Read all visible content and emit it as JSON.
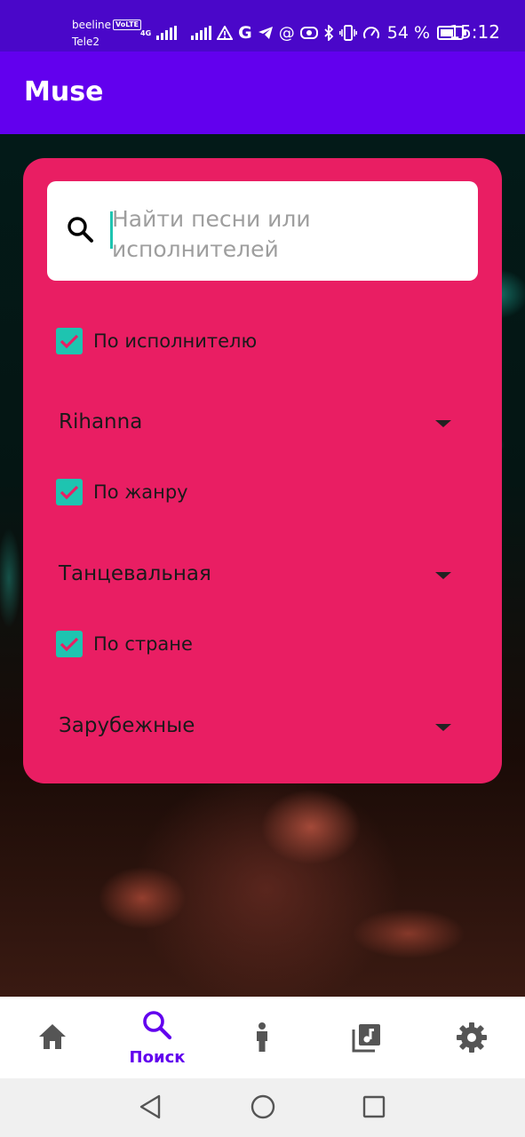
{
  "status_bar": {
    "carrier_1": "beeline",
    "volte": "VoLTE",
    "carrier_2": "Tele2",
    "network": "4G",
    "battery_percent": "54 %",
    "time": "15:12",
    "icons": [
      "signal-icon",
      "signal-icon",
      "warning-icon",
      "google-icon",
      "telegram-icon",
      "at-icon",
      "vpn-icon",
      "bluetooth-icon",
      "vibrate-icon",
      "speedometer-icon",
      "battery-icon"
    ]
  },
  "app_bar": {
    "title": "Muse"
  },
  "search": {
    "placeholder": "Найти песни или исполнителей",
    "value": ""
  },
  "filters": [
    {
      "label": "По исполнителю",
      "checked": true,
      "selected": "Rihanna"
    },
    {
      "label": "По жанру",
      "checked": true,
      "selected": "Танцевальная"
    },
    {
      "label": "По стране",
      "checked": true,
      "selected": "Зарубежные"
    }
  ],
  "bottom_nav": {
    "items": [
      {
        "icon": "home-icon",
        "label": ""
      },
      {
        "icon": "search-icon",
        "label": "Поиск",
        "active": true
      },
      {
        "icon": "person-icon",
        "label": ""
      },
      {
        "icon": "music-library-icon",
        "label": ""
      },
      {
        "icon": "gear-icon",
        "label": ""
      }
    ]
  },
  "colors": {
    "status_bar": "#4a07c9",
    "app_bar": "#6200ee",
    "card": "#e91e63",
    "accent": "#1ec4b0",
    "nav_active": "#6200ee",
    "nav_inactive": "#555555"
  }
}
